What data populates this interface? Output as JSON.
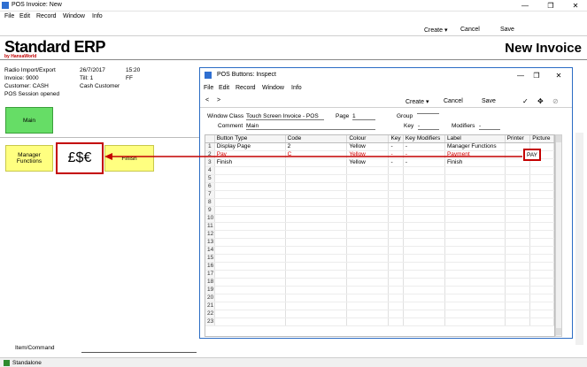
{
  "window": {
    "title": "POS Invoice: New",
    "min": "—",
    "max": "❐",
    "close": "✕"
  },
  "menu": [
    "File",
    "Edit",
    "Record",
    "Window",
    "Info"
  ],
  "toolbar": {
    "create": "Create",
    "cancel": "Cancel",
    "save": "Save"
  },
  "brand": {
    "name": "Standard ERP",
    "sub": "by HansaWorld"
  },
  "doc_title": "New Invoice",
  "info": {
    "line1_a": "Radio Import/Export",
    "line1_b": "26/7/2017",
    "line1_c": "15:20",
    "line2_a": "Invoice: 9000",
    "line2_b": "Till: 1",
    "line2_c": "FF",
    "line3_a": "Customer: CASH",
    "line3_b": "Cash Customer",
    "line4_a": "POS Session opened"
  },
  "pos_buttons": {
    "main": "Main",
    "manager": "Manager Functions",
    "finish": "Finish"
  },
  "callout_big": "£$€",
  "callout_small": "PAY",
  "command": {
    "label": "Item/Command"
  },
  "status": {
    "text": "Standalone"
  },
  "dialog": {
    "title": "POS Buttons: Inspect",
    "window_class_label": "Window Class",
    "window_class_value": "Touch Screen Invoice - POS",
    "page_label": "Page",
    "page_value": "1",
    "group_label": "Group",
    "comment_label": "Comment",
    "comment_value": "Main",
    "key_label": "Key",
    "key_value": "-",
    "modifiers_label": "Modifiers",
    "modifiers_value": "-",
    "columns": [
      "",
      "Button Type",
      "Code",
      "Colour",
      "Key",
      "Key Modifiers",
      "Label",
      "Printer",
      "Picture"
    ],
    "rows": [
      [
        "1",
        "Display Page",
        "2",
        "Yellow",
        "-",
        "-",
        "Manager Functions",
        "",
        ""
      ],
      [
        "2",
        "Pay",
        "C",
        "Yellow",
        "-",
        "-",
        "Payment",
        "",
        ""
      ],
      [
        "3",
        "Finish",
        "",
        "Yellow",
        "-",
        "-",
        "Finish",
        "",
        ""
      ],
      [
        "4",
        "",
        "",
        "",
        "",
        "",
        "",
        "",
        ""
      ],
      [
        "5",
        "",
        "",
        "",
        "",
        "",
        "",
        "",
        ""
      ],
      [
        "6",
        "",
        "",
        "",
        "",
        "",
        "",
        "",
        ""
      ],
      [
        "7",
        "",
        "",
        "",
        "",
        "",
        "",
        "",
        ""
      ],
      [
        "8",
        "",
        "",
        "",
        "",
        "",
        "",
        "",
        ""
      ],
      [
        "9",
        "",
        "",
        "",
        "",
        "",
        "",
        "",
        ""
      ],
      [
        "10",
        "",
        "",
        "",
        "",
        "",
        "",
        "",
        ""
      ],
      [
        "11",
        "",
        "",
        "",
        "",
        "",
        "",
        "",
        ""
      ],
      [
        "12",
        "",
        "",
        "",
        "",
        "",
        "",
        "",
        ""
      ],
      [
        "13",
        "",
        "",
        "",
        "",
        "",
        "",
        "",
        ""
      ],
      [
        "14",
        "",
        "",
        "",
        "",
        "",
        "",
        "",
        ""
      ],
      [
        "15",
        "",
        "",
        "",
        "",
        "",
        "",
        "",
        ""
      ],
      [
        "16",
        "",
        "",
        "",
        "",
        "",
        "",
        "",
        ""
      ],
      [
        "17",
        "",
        "",
        "",
        "",
        "",
        "",
        "",
        ""
      ],
      [
        "18",
        "",
        "",
        "",
        "",
        "",
        "",
        "",
        ""
      ],
      [
        "19",
        "",
        "",
        "",
        "",
        "",
        "",
        "",
        ""
      ],
      [
        "20",
        "",
        "",
        "",
        "",
        "",
        "",
        "",
        ""
      ],
      [
        "21",
        "",
        "",
        "",
        "",
        "",
        "",
        "",
        ""
      ],
      [
        "22",
        "",
        "",
        "",
        "",
        "",
        "",
        "",
        ""
      ],
      [
        "23",
        "",
        "",
        "",
        "",
        "",
        "",
        "",
        ""
      ]
    ],
    "red_row": 1
  }
}
